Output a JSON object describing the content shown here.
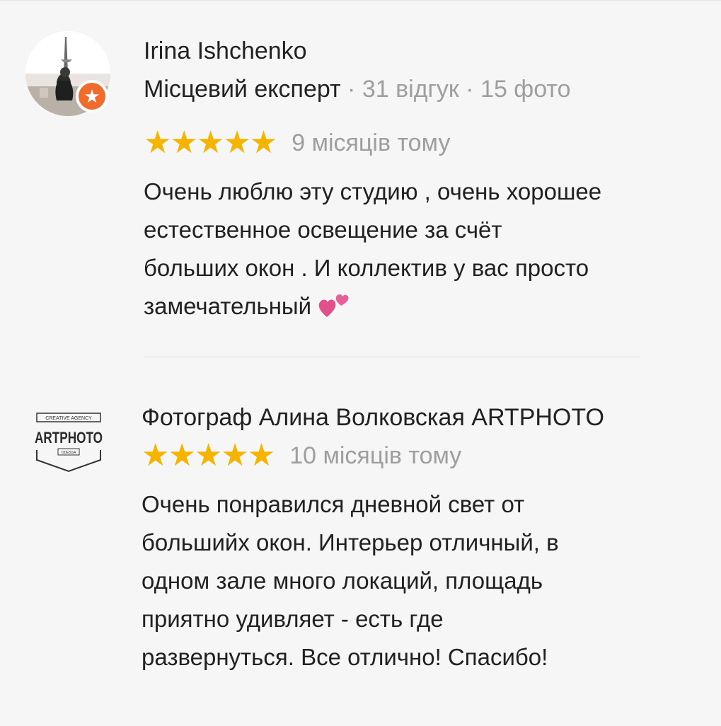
{
  "reviews": [
    {
      "author": "Irina Ishchenko",
      "role": "Місцевий експерт",
      "separator": " · ",
      "reviews_count": "31 відгук",
      "photos_count": "15 фото",
      "stars": "★★★★★",
      "rating": 5,
      "date": "9 місяців тому",
      "text": "Очень люблю эту студию , очень хорошее\nестественное освещение за счёт\nбольших окон .  И коллектив у вас просто\nзамечательный",
      "avatar_icon": "user-photo",
      "badge_icon": "local-guide-star-icon",
      "emoji_icon": "two-hearts-icon"
    },
    {
      "author": "Фотограф Алина Волковская ARTPHOTO",
      "stars": "★★★★★",
      "rating": 5,
      "date": "10 місяців тому",
      "text": "Очень понравился дневной свет от\nбольшийх окон. Интерьер отличный, в\nодном зале много локаций, площадь\nприятно удивляет - есть где\nразвернуться. Все отлично! Спасибо!",
      "logo": {
        "top": "CREATIVE AGENCY",
        "main": "ARTPHOTO",
        "bottom": "ODESSA"
      }
    }
  ],
  "colors": {
    "star": "#f4b400",
    "badge": "#ef6c2c",
    "muted": "#9e9e9e",
    "text": "#212121",
    "heart": "#e0508a",
    "background": "#f6f6f6"
  }
}
